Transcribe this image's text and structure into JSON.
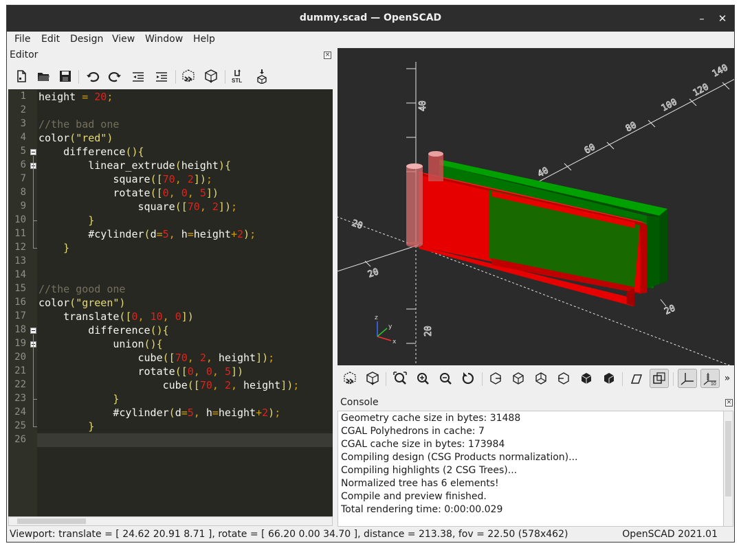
{
  "window": {
    "title": "dummy.scad — OpenSCAD",
    "minimize_glyph": "–",
    "close_glyph": "✕"
  },
  "menu": [
    "File",
    "Edit",
    "Design",
    "View",
    "Window",
    "Help"
  ],
  "editor": {
    "title": "Editor",
    "toolbar": [
      "new-file-icon",
      "open-file-icon",
      "save-icon",
      "undo-icon",
      "redo-icon",
      "unindent-icon",
      "indent-icon",
      "preview-icon",
      "render-icon",
      "export-stl-icon",
      "send-to-print-icon"
    ],
    "stl_label": "STL",
    "lines": [
      "height = 20;",
      "",
      "//the bad one",
      "color(\"red\")",
      "    difference(){",
      "        linear_extrude(height){",
      "            square([70, 2]);",
      "            rotate([0, 0, 5])",
      "                square([70, 2]);",
      "        }",
      "        #cylinder(d=5, h=height+2);",
      "    }",
      "",
      "",
      "//the good one",
      "color(\"green\")",
      "    translate([0, 10, 0])",
      "        difference(){",
      "            union(){",
      "                cube([70, 2, height]);",
      "                rotate([0, 0, 5])",
      "                    cube([70, 2, height]);",
      "            }",
      "            #cylinder(d=5, h=height+2);",
      "        }",
      ""
    ]
  },
  "viewport": {
    "axis_labels": [
      "40",
      "20",
      "20",
      "20",
      "20",
      "40",
      "60",
      "80",
      "100",
      "120",
      "140"
    ],
    "gizmo": {
      "x": "x",
      "y": "y",
      "z": "z"
    },
    "colors": {
      "background": "#2b2b2b",
      "red": "#e00000",
      "green": "#007400",
      "highlight": "#e8a0a0"
    }
  },
  "view_toolbar": [
    "preview-icon",
    "render-icon",
    "view-all-icon",
    "zoom-in-icon",
    "zoom-out-icon",
    "reset-view-icon",
    "view-right-icon",
    "view-top-icon",
    "view-bottom-icon",
    "view-left-icon",
    "view-front-icon",
    "view-back-icon",
    "perspective-icon",
    "orthogonal-icon",
    "show-axes-icon",
    "show-scale-markers-icon",
    "more-icon"
  ],
  "console": {
    "title": "Console",
    "lines": [
      "Geometry cache size in bytes: 31488",
      "CGAL Polyhedrons in cache: 7",
      "CGAL cache size in bytes: 173984",
      "Compiling design (CSG Products normalization)...",
      "Compiling highlights (2 CSG Trees)...",
      "Normalized tree has 6 elements!",
      "Compile and preview finished.",
      "Total rendering time: 0:00:00.029"
    ]
  },
  "status": {
    "left": "Viewport: translate = [ 24.62 20.91 8.71 ], rotate = [ 66.20 0.00 34.70 ], distance = 213.38, fov = 22.50 (578x462)",
    "right": "OpenSCAD 2021.01"
  }
}
